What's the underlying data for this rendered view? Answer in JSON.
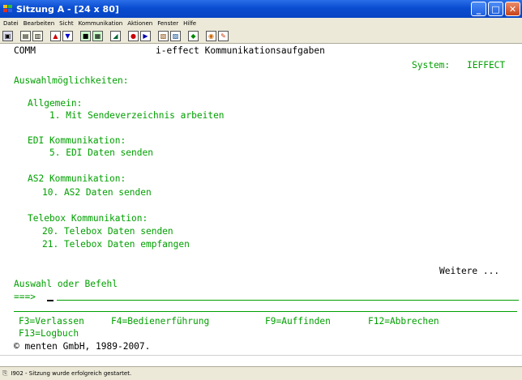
{
  "window": {
    "title": "Sitzung A - [24 x 80]",
    "controls": {
      "minimize": "_",
      "maximize": "□",
      "close": "✕"
    }
  },
  "menu": [
    "Datei",
    "Bearbeiten",
    "Sicht",
    "Kommunikation",
    "Aktionen",
    "Fenster",
    "Hilfe"
  ],
  "toolbar": {
    "icons": [
      "print-screen-icon",
      "copy-icon",
      "paste-icon",
      "send-icon",
      "receive-icon",
      "display-icon",
      "keypad-icon",
      "macro-icon",
      "record-icon",
      "play-icon",
      "clipboard-icon",
      "save-icon",
      "settings-icon",
      "color-icon",
      "edit-icon"
    ]
  },
  "screen": {
    "program": "COMM",
    "heading": "i-effect Kommunikationsaufgaben",
    "system_label": "System:",
    "system_value": "IEFFECT",
    "options_header": "Auswahlmöglichkeiten:",
    "groups": [
      {
        "title": "Allgemein:",
        "items": [
          "1. Mit Sendeverzeichnis arbeiten"
        ]
      },
      {
        "title": "EDI Kommunikation:",
        "items": [
          "5. EDI Daten senden"
        ]
      },
      {
        "title": "AS2 Kommunikation:",
        "items": [
          "10. AS2 Daten senden"
        ]
      },
      {
        "title": "Telebox Kommunikation:",
        "items": [
          "20. Telebox Daten senden",
          "21. Telebox Daten empfangen"
        ]
      }
    ],
    "more": "Weitere ...",
    "prompt_label": "Auswahl oder Befehl",
    "prompt_arrow": "===>",
    "command_value": "",
    "function_keys": [
      "F3=Verlassen",
      "F4=Bedienerführung",
      "F9=Auffinden",
      "F12=Abbrechen",
      "F13=Logbuch"
    ],
    "copyright": "© menten GmbH, 1989-2007."
  },
  "status": {
    "message": "I902 - Sitzung wurde erfolgreich gestartet."
  },
  "colors": {
    "terminal_text": "#00a000",
    "titlebar": "#0a4cd0"
  }
}
